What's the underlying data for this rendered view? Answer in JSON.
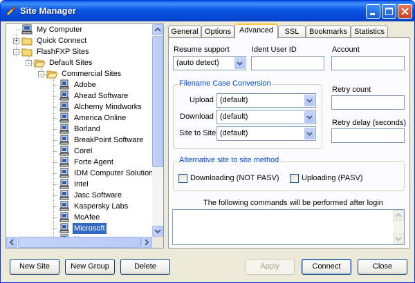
{
  "window": {
    "title": "Site Manager",
    "controls": [
      "minimize-icon",
      "maximize-icon",
      "close-icon"
    ]
  },
  "tree": {
    "items": [
      {
        "label": "My Computer",
        "icon": "computer-icon"
      },
      {
        "label": "Quick Connect",
        "icon": "folder-icon",
        "expander": "+"
      },
      {
        "label": "FlashFXP Sites",
        "icon": "folder-icon",
        "expander": "-"
      },
      {
        "label": "Default Sites",
        "icon": "folder-open-icon",
        "expander": "-"
      },
      {
        "label": "Commercial Sites",
        "icon": "folder-open-icon",
        "expander": "-"
      },
      {
        "label": "Adobe",
        "icon": "server-icon"
      },
      {
        "label": "Ahead Software",
        "icon": "server-icon"
      },
      {
        "label": "Alchemy Mindworks",
        "icon": "server-icon"
      },
      {
        "label": "America Online",
        "icon": "server-icon"
      },
      {
        "label": "Borland",
        "icon": "server-icon"
      },
      {
        "label": "BreakPoint Software",
        "icon": "server-icon"
      },
      {
        "label": "Corel",
        "icon": "server-icon"
      },
      {
        "label": "Forte Agent",
        "icon": "server-icon"
      },
      {
        "label": "IDM Computer Solutions",
        "icon": "server-icon"
      },
      {
        "label": "Intel",
        "icon": "server-icon"
      },
      {
        "label": "Jasc Software",
        "icon": "server-icon"
      },
      {
        "label": "Kaspersky Labs",
        "icon": "server-icon"
      },
      {
        "label": "McAfee",
        "icon": "server-icon"
      },
      {
        "label": "Microsoft",
        "icon": "server-icon",
        "selected": true
      },
      {
        "label": "Netscape",
        "icon": "server-icon"
      }
    ]
  },
  "tabs": [
    {
      "label": "General"
    },
    {
      "label": "Options"
    },
    {
      "label": "Advanced",
      "active": true
    },
    {
      "label": "SSL"
    },
    {
      "label": "Bookmarks"
    },
    {
      "label": "Statistics"
    }
  ],
  "advanced": {
    "resume_support_label": "Resume support",
    "resume_support_value": "(auto detect)",
    "ident_user_id_label": "Ident User ID",
    "ident_user_id_value": "",
    "account_label": "Account",
    "account_value": "",
    "case_group_title": "Filename Case Conversion",
    "upload_label": "Upload",
    "upload_value": "(default)",
    "download_label": "Download",
    "download_value": "(default)",
    "site_to_site_label": "Site to Site",
    "site_to_site_value": "(default)",
    "retry_count_label": "Retry count",
    "retry_count_value": "",
    "retry_delay_label": "Retry delay (seconds)",
    "retry_delay_value": "",
    "alt_group_title": "Alternative site to site method",
    "downloading_label": "Downloading (NOT PASV)",
    "downloading_checked": false,
    "uploading_label": "Uploading (PASV)",
    "uploading_checked": false,
    "commands_label": "The following commands will be performed after login",
    "commands_value": ""
  },
  "buttons": {
    "new_site": "New Site",
    "new_group": "New Group",
    "delete": "Delete",
    "apply": "Apply",
    "connect": "Connect",
    "close": "Close"
  },
  "colors": {
    "titlebar": "#0a54e3",
    "selection": "#316ac5",
    "group_title": "#0046d5",
    "active_tab_accent": "#ffc83c"
  }
}
